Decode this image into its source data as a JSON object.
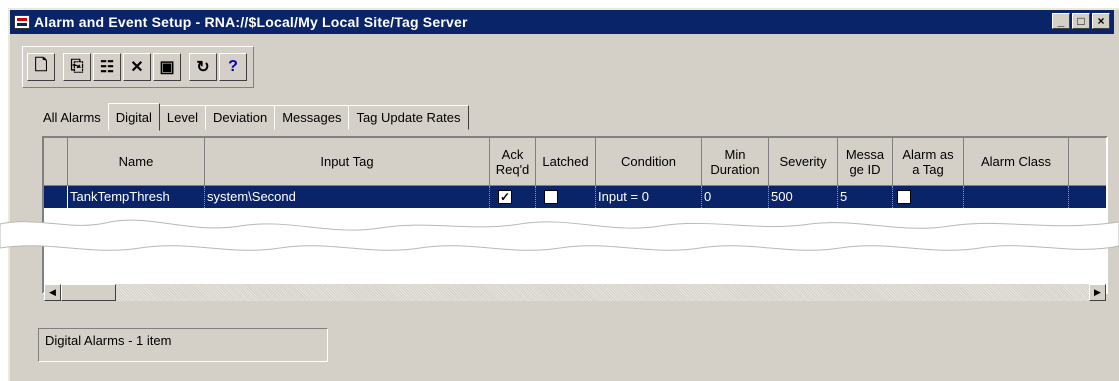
{
  "window": {
    "title": "Alarm and Event Setup - RNA://$Local/My Local Site/Tag Server"
  },
  "window_controls": {
    "minimize": "_",
    "restore": "□",
    "close": "×"
  },
  "toolbar": {
    "buttons": [
      {
        "name": "new-icon",
        "glyph": "🗋"
      },
      {
        "name": "duplicate-icon",
        "glyph": "⎘"
      },
      {
        "name": "properties-icon",
        "glyph": "☷"
      },
      {
        "name": "delete-icon",
        "glyph": "✕"
      },
      {
        "name": "save-icon",
        "glyph": "▣"
      },
      {
        "name": "refresh-icon",
        "glyph": "↻"
      },
      {
        "name": "help-icon",
        "glyph": "?"
      }
    ]
  },
  "tabs": [
    "All Alarms",
    "Digital",
    "Level",
    "Deviation",
    "Messages",
    "Tag Update Rates"
  ],
  "active_tab": "Digital",
  "grid": {
    "columns": [
      "Name",
      "Input Tag",
      "Ack Req'd",
      "Latched",
      "Condition",
      "Min Duration",
      "Severity",
      "Message ID",
      "Alarm as a Tag",
      "Alarm Class"
    ],
    "column_display": [
      "Name",
      "Input Tag",
      "Ack\nReq'd",
      "Latched",
      "Condition",
      "Min\nDuration",
      "Severity",
      "Messa\nge ID",
      "Alarm as\na Tag",
      "Alarm Class"
    ],
    "rows": [
      {
        "name": "TankTempThresh",
        "input_tag": "system\\Second",
        "ack_reqd": true,
        "latched": false,
        "condition": "Input = 0",
        "min_duration": "0",
        "severity": "500",
        "message_id": "5",
        "alarm_as_tag": false,
        "alarm_class": ""
      }
    ]
  },
  "status": {
    "text": "Digital Alarms - 1 item"
  },
  "colors": {
    "title_bar": "#0a246a",
    "selection": "#0a246a",
    "face": "#d4d0c8"
  }
}
